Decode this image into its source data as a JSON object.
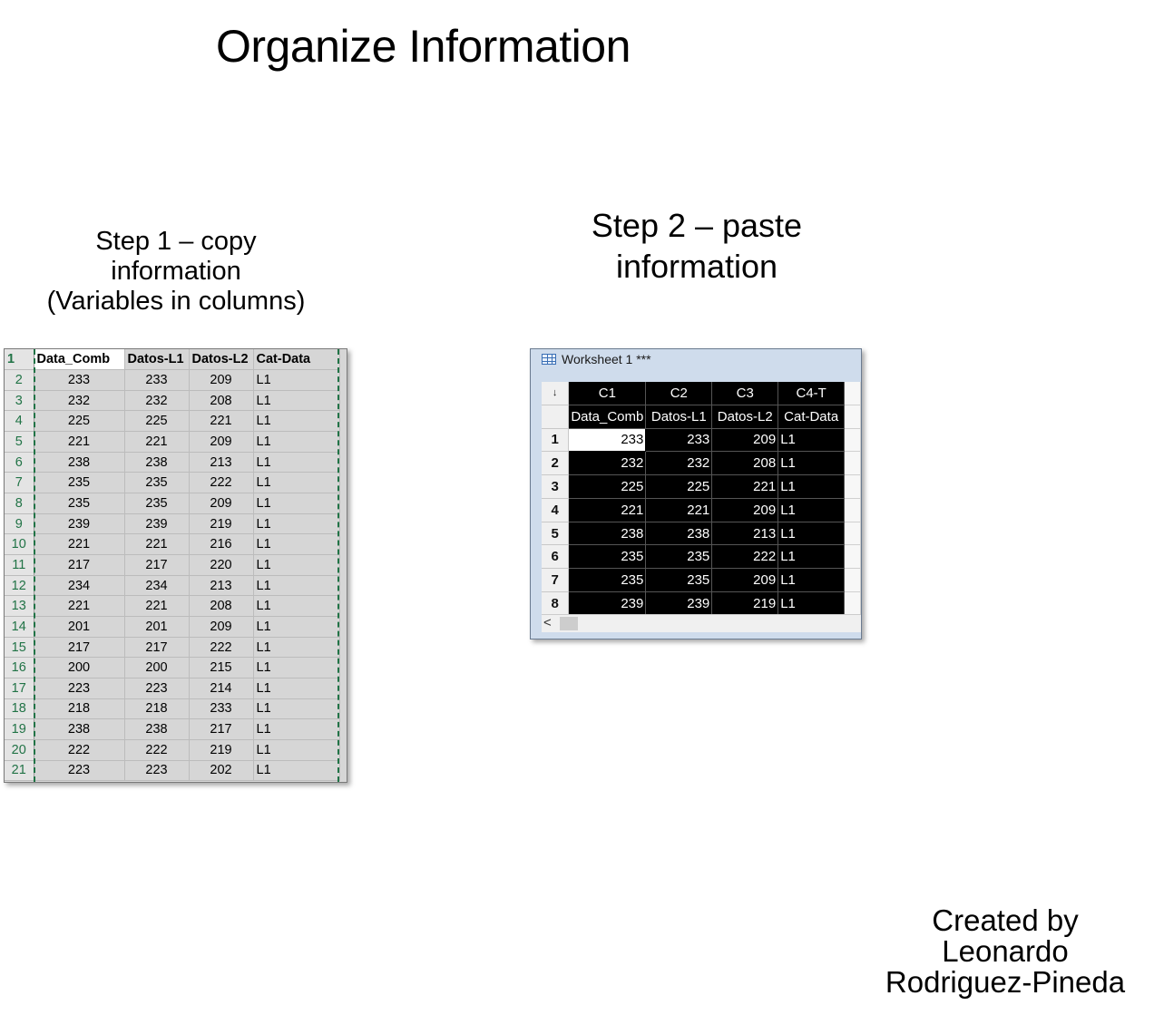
{
  "title": "Organize Information",
  "step1": {
    "line1": "Step 1 – copy",
    "line2": "information",
    "line3": "(Variables in columns)"
  },
  "step2": {
    "line1": "Step 2 – paste",
    "line2": "information"
  },
  "credit": {
    "line1": "Created by",
    "line2": "Leonardo",
    "line3": "Rodriguez-Pineda"
  },
  "excel": {
    "headers": [
      "Data_Comb",
      "Datos-L1",
      "Datos-L2",
      "Cat-Data"
    ],
    "rows": [
      [
        "2",
        "233",
        "233",
        "209",
        "L1"
      ],
      [
        "3",
        "232",
        "232",
        "208",
        "L1"
      ],
      [
        "4",
        "225",
        "225",
        "221",
        "L1"
      ],
      [
        "5",
        "221",
        "221",
        "209",
        "L1"
      ],
      [
        "6",
        "238",
        "238",
        "213",
        "L1"
      ],
      [
        "7",
        "235",
        "235",
        "222",
        "L1"
      ],
      [
        "8",
        "235",
        "235",
        "209",
        "L1"
      ],
      [
        "9",
        "239",
        "239",
        "219",
        "L1"
      ],
      [
        "10",
        "221",
        "221",
        "216",
        "L1"
      ],
      [
        "11",
        "217",
        "217",
        "220",
        "L1"
      ],
      [
        "12",
        "234",
        "234",
        "213",
        "L1"
      ],
      [
        "13",
        "221",
        "221",
        "208",
        "L1"
      ],
      [
        "14",
        "201",
        "201",
        "209",
        "L1"
      ],
      [
        "15",
        "217",
        "217",
        "222",
        "L1"
      ],
      [
        "16",
        "200",
        "200",
        "215",
        "L1"
      ],
      [
        "17",
        "223",
        "223",
        "214",
        "L1"
      ],
      [
        "18",
        "218",
        "218",
        "233",
        "L1"
      ],
      [
        "19",
        "238",
        "238",
        "217",
        "L1"
      ],
      [
        "20",
        "222",
        "222",
        "219",
        "L1"
      ],
      [
        "21",
        "223",
        "223",
        "202",
        "L1"
      ]
    ],
    "header_row_number": "1"
  },
  "minitab": {
    "window_title": "Worksheet 1 ***",
    "corner": "↓",
    "columns": [
      "C1",
      "C2",
      "C3",
      "C4-T"
    ],
    "names": [
      "Data_Comb",
      "Datos-L1",
      "Datos-L2",
      "Cat-Data"
    ],
    "rows": [
      [
        "1",
        "233",
        "233",
        "209",
        "L1"
      ],
      [
        "2",
        "232",
        "232",
        "208",
        "L1"
      ],
      [
        "3",
        "225",
        "225",
        "221",
        "L1"
      ],
      [
        "4",
        "221",
        "221",
        "209",
        "L1"
      ],
      [
        "5",
        "238",
        "238",
        "213",
        "L1"
      ],
      [
        "6",
        "235",
        "235",
        "222",
        "L1"
      ],
      [
        "7",
        "235",
        "235",
        "209",
        "L1"
      ],
      [
        "8",
        "239",
        "239",
        "219",
        "L1"
      ]
    ],
    "scroll_arrow": "<"
  }
}
